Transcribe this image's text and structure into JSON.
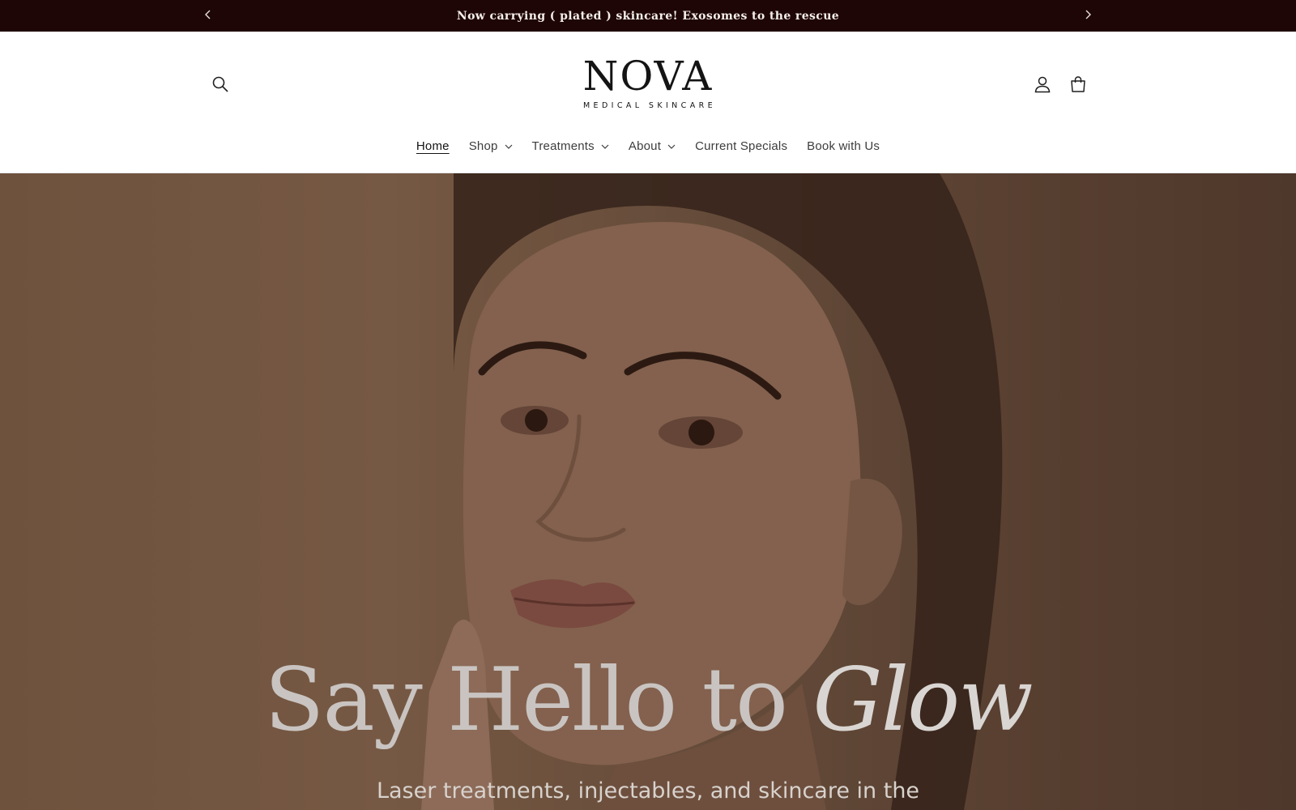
{
  "announcement": {
    "text": "Now carrying ( plated ) skincare! Exosomes to the rescue",
    "prev_icon": "chevron-left-icon",
    "next_icon": "chevron-right-icon"
  },
  "header": {
    "logo_title": "NOVA",
    "logo_subtitle": "MEDICAL SKINCARE",
    "search_icon": "search-icon",
    "account_icon": "account-icon",
    "cart_icon": "cart-icon"
  },
  "nav": {
    "items": [
      {
        "label": "Home",
        "active": true,
        "dropdown": false
      },
      {
        "label": "Shop",
        "active": false,
        "dropdown": true
      },
      {
        "label": "Treatments",
        "active": false,
        "dropdown": true
      },
      {
        "label": "About",
        "active": false,
        "dropdown": true
      },
      {
        "label": "Current Specials",
        "active": false,
        "dropdown": false
      },
      {
        "label": "Book with Us",
        "active": false,
        "dropdown": false
      }
    ]
  },
  "hero": {
    "title_main": "Say Hello to",
    "title_emphasis": "Glow",
    "subtitle": "Laser treatments, injectables, and skincare in the"
  },
  "colors": {
    "announcement_bg": "#1f0606",
    "hero_tone": "#8a6a52"
  }
}
